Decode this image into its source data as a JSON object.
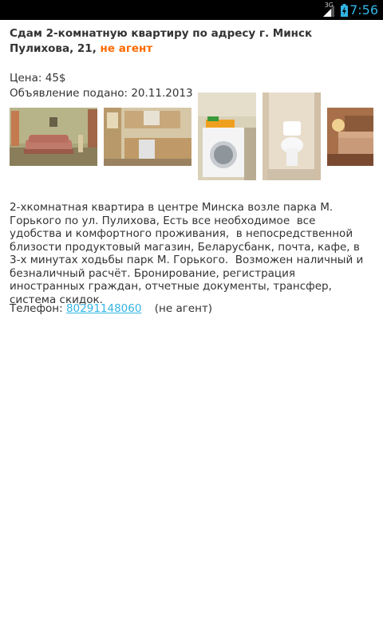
{
  "status_bar": {
    "network": "3G",
    "time": "7:56",
    "icons": [
      "signal-icon",
      "battery-charging-icon"
    ]
  },
  "listing": {
    "title": "Сдам 2-комнатную квартиру по адресу г. Минск Пулихова, 21,",
    "agent_tag": "не агент",
    "price": "Цена: 45$",
    "posted": "Объявление подано: 20.11.2013",
    "photos": [
      "living-room-sofa-photo",
      "kitchen-photo",
      "washing-machine-photo",
      "toilet-photo",
      "bedroom-photo"
    ],
    "description": "2-хкомнатная квартира в центре Минска возле парка М. Горького по ул. Пулихова, Есть все необходимое  все удобства и комфортного проживания,  в непосредственной близости продуктовый магазин, Беларусбанк, почта, кафе, в 3-х минутах ходьбы парк М. Горького.  Возможен наличный и безналичный расчёт. Бронирование, регистрация иностранных граждан, отчетные документы, трансфер, система скидок.",
    "phone_label": "Телефон:",
    "phone_number": "80291148060",
    "phone_note": "(не агент)"
  },
  "colors": {
    "accent": "#33b5e5",
    "agent_tag": "#ff6a00",
    "text": "#333333"
  }
}
